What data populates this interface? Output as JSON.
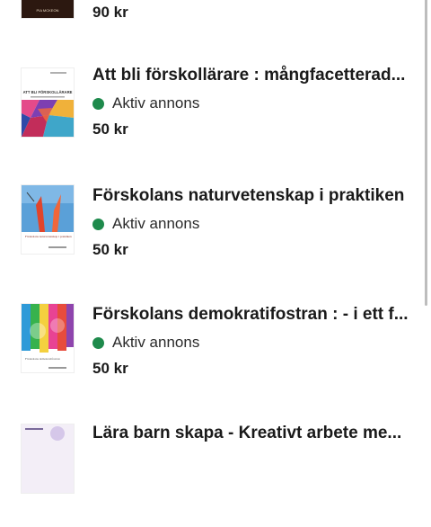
{
  "listings": [
    {
      "title": "",
      "status": "",
      "price": "90 kr",
      "cover_text": "PIA MCKEON"
    },
    {
      "title": "Att bli förskollärare : mångfacetterad...",
      "status": "Aktiv annons",
      "price": "50 kr",
      "cover_text": "ATT BLI FÖRSKOLLÄRARE"
    },
    {
      "title": "Förskolans naturvetenskap i praktiken",
      "status": "Aktiv annons",
      "price": "50 kr",
      "cover_text": "Förskolans naturvetenskap i praktiken"
    },
    {
      "title": "Förskolans demokratifostran : - i ett f...",
      "status": "Aktiv annons",
      "price": "50 kr",
      "cover_text": "Förskolans demokratifostran"
    },
    {
      "title": "Lära barn skapa - Kreativt arbete me...",
      "status": "",
      "price": "",
      "cover_text": ""
    }
  ],
  "colors": {
    "status_dot": "#1e8a4c",
    "text": "#1a1a1a",
    "background": "#ffffff"
  }
}
